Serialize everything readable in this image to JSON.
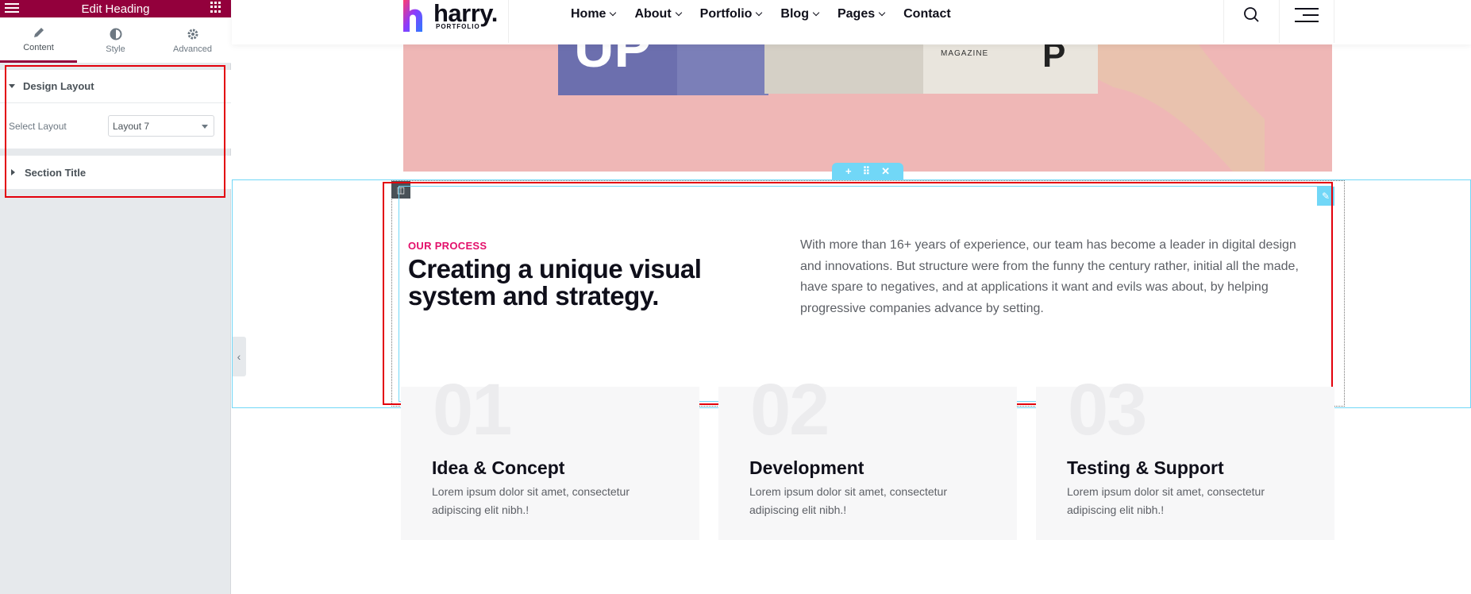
{
  "panel": {
    "title": "Edit Heading",
    "tabs": [
      {
        "label": "Content",
        "icon": "pencil-icon"
      },
      {
        "label": "Style",
        "icon": "contrast-icon"
      },
      {
        "label": "Advanced",
        "icon": "gear-icon"
      }
    ],
    "sections": {
      "design_layout": "Design Layout",
      "select_layout_label": "Select Layout",
      "select_layout_value": "Layout 7",
      "section_title": "Section Title"
    }
  },
  "header": {
    "logo_name": "harry.",
    "logo_sub": "PORTFOLIO",
    "nav": [
      "Home",
      "About",
      "Portfolio",
      "Blog",
      "Pages",
      "Contact"
    ],
    "nav_dropdown": [
      true,
      true,
      true,
      true,
      true,
      false
    ]
  },
  "hero": {
    "mag_left_text": "UP",
    "mag_right_text": "MAGAZINE",
    "mag_right_letter": "P"
  },
  "process": {
    "tag": "OUR PROCESS",
    "title": "Creating a unique visual system and strategy.",
    "text": "With more than 16+ years of experience, our team has become a leader in digital design and innovations. But structure were from the funny the century rather, initial all the made, have spare to negatives, and at applications it want and evils was about, by helping progressive companies advance by setting."
  },
  "cards": [
    {
      "num": "01",
      "title": "Idea & Concept",
      "text": "Lorem ipsum dolor sit amet, consectetur adipiscing elit nibh.!"
    },
    {
      "num": "02",
      "title": "Development",
      "text": "Lorem ipsum dolor sit amet, consectetur adipiscing elit nibh.!"
    },
    {
      "num": "03",
      "title": "Testing & Support",
      "text": "Lorem ipsum dolor sit amet, consectetur adipiscing elit nibh.!"
    }
  ],
  "colors": {
    "panel_accent": "#93003c",
    "selection": "#71d7f7",
    "highlight_box": "#e3000b",
    "tag_pink": "#e3106b"
  }
}
